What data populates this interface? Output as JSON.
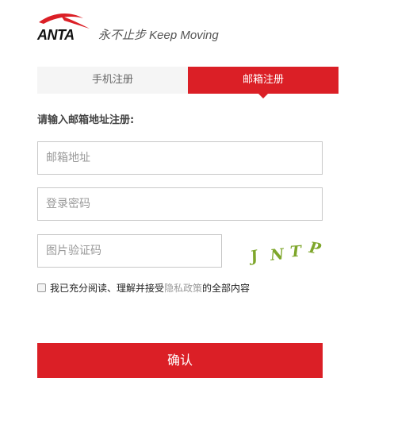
{
  "header": {
    "logo_text": "ANTA",
    "slogan": "永不止步 Keep Moving"
  },
  "tabs": [
    {
      "label": "手机注册",
      "active": false
    },
    {
      "label": "邮箱注册",
      "active": true
    }
  ],
  "form": {
    "title": "请输入邮箱地址注册:",
    "email_placeholder": "邮箱地址",
    "password_placeholder": "登录密码",
    "captcha_placeholder": "图片验证码",
    "captcha_chars": [
      "J",
      "N",
      "T",
      "P"
    ],
    "agree_prefix": "我已充分阅读、理解并接受",
    "policy_link": "隐私政策",
    "agree_suffix": "的全部内容",
    "agree_checked": false,
    "confirm_label": "确认"
  },
  "colors": {
    "brand_red": "#db1f26",
    "captcha_green": "#7ea62b"
  }
}
